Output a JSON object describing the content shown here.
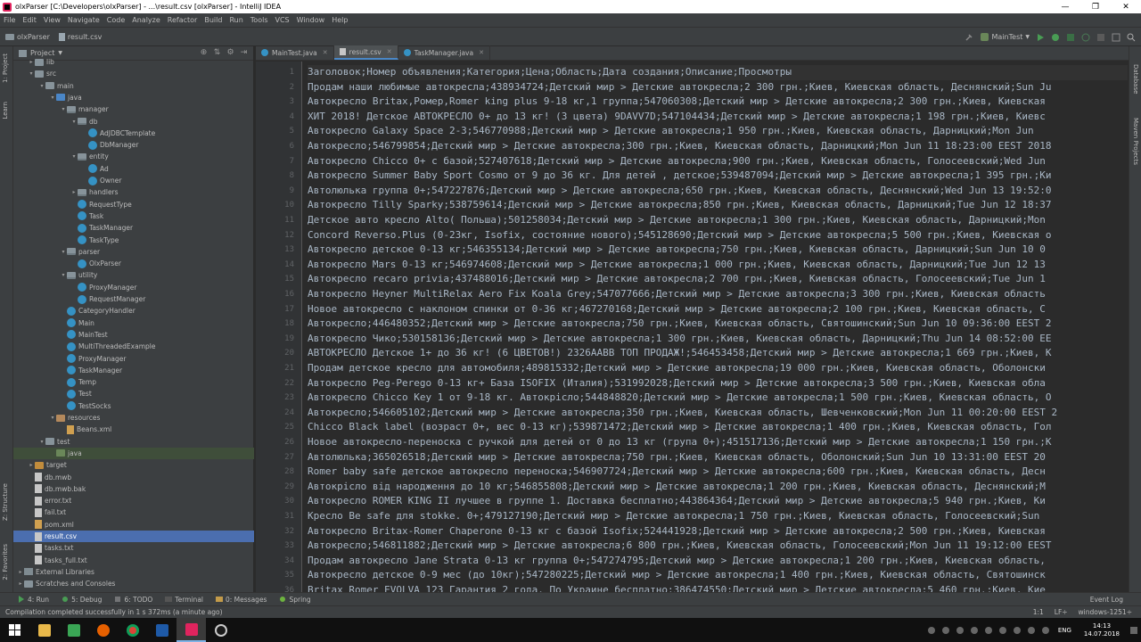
{
  "window": {
    "title": "olxParser [C:\\Developers\\olxParser] - ...\\result.csv [olxParser] - IntelliJ IDEA",
    "minimize": "—",
    "maximize": "❐",
    "close": "✕"
  },
  "menu": [
    "File",
    "Edit",
    "View",
    "Navigate",
    "Code",
    "Analyze",
    "Refactor",
    "Build",
    "Run",
    "Tools",
    "VCS",
    "Window",
    "Help"
  ],
  "breadcrumb": {
    "project": "olxParser",
    "file": "result.csv"
  },
  "run_config": "MainTest",
  "project_panel": {
    "title": "Project"
  },
  "left_tabs": {
    "project": "1: Project",
    "learn": "Learn",
    "structure": "Z: Structure",
    "favorites": "2: Favorites"
  },
  "right_tabs": {
    "database": "Database",
    "maven": "Maven Projects"
  },
  "tree": [
    {
      "label": "lib",
      "depth": 1,
      "icon": "folder",
      "arrow": "▸"
    },
    {
      "label": "src",
      "depth": 1,
      "icon": "folder",
      "arrow": "▾"
    },
    {
      "label": "main",
      "depth": 2,
      "icon": "folder",
      "arrow": "▾"
    },
    {
      "label": "java",
      "depth": 3,
      "icon": "src",
      "arrow": "▾"
    },
    {
      "label": "manager",
      "depth": 4,
      "icon": "pkg",
      "arrow": "▾"
    },
    {
      "label": "db",
      "depth": 5,
      "icon": "pkg",
      "arrow": "▾"
    },
    {
      "label": "AdJDBCTemplate",
      "depth": 6,
      "icon": "cls",
      "arrow": ""
    },
    {
      "label": "DbManager",
      "depth": 6,
      "icon": "cls",
      "arrow": ""
    },
    {
      "label": "entity",
      "depth": 5,
      "icon": "pkg",
      "arrow": "▾"
    },
    {
      "label": "Ad",
      "depth": 6,
      "icon": "cls",
      "arrow": ""
    },
    {
      "label": "Owner",
      "depth": 6,
      "icon": "cls",
      "arrow": ""
    },
    {
      "label": "handlers",
      "depth": 5,
      "icon": "pkg",
      "arrow": "▸"
    },
    {
      "label": "RequestType",
      "depth": 5,
      "icon": "enm",
      "arrow": ""
    },
    {
      "label": "Task",
      "depth": 5,
      "icon": "cls",
      "arrow": ""
    },
    {
      "label": "TaskManager",
      "depth": 5,
      "icon": "cls",
      "arrow": ""
    },
    {
      "label": "TaskType",
      "depth": 5,
      "icon": "enm",
      "arrow": ""
    },
    {
      "label": "parser",
      "depth": 4,
      "icon": "pkg",
      "arrow": "▾"
    },
    {
      "label": "OlxParser",
      "depth": 5,
      "icon": "cls",
      "arrow": ""
    },
    {
      "label": "utility",
      "depth": 4,
      "icon": "pkg",
      "arrow": "▾"
    },
    {
      "label": "ProxyManager",
      "depth": 5,
      "icon": "cls",
      "arrow": ""
    },
    {
      "label": "RequestManager",
      "depth": 5,
      "icon": "cls",
      "arrow": ""
    },
    {
      "label": "CategoryHandler",
      "depth": 4,
      "icon": "cls",
      "arrow": ""
    },
    {
      "label": "Main",
      "depth": 4,
      "icon": "cls",
      "arrow": ""
    },
    {
      "label": "MainTest",
      "depth": 4,
      "icon": "cls",
      "arrow": ""
    },
    {
      "label": "MultiThreadedExample",
      "depth": 4,
      "icon": "cls",
      "arrow": ""
    },
    {
      "label": "ProxyManager",
      "depth": 4,
      "icon": "cls",
      "arrow": ""
    },
    {
      "label": "TaskManager",
      "depth": 4,
      "icon": "cls",
      "arrow": ""
    },
    {
      "label": "Temp",
      "depth": 4,
      "icon": "cls",
      "arrow": ""
    },
    {
      "label": "Test",
      "depth": 4,
      "icon": "cls",
      "arrow": ""
    },
    {
      "label": "TestSocks",
      "depth": 4,
      "icon": "cls",
      "arrow": ""
    },
    {
      "label": "resources",
      "depth": 3,
      "icon": "res",
      "arrow": "▾"
    },
    {
      "label": "Beans.xml",
      "depth": 4,
      "icon": "xml",
      "arrow": ""
    },
    {
      "label": "test",
      "depth": 2,
      "icon": "folder",
      "arrow": "▾"
    },
    {
      "label": "java",
      "depth": 3,
      "icon": "tst",
      "arrow": "",
      "hl": true
    },
    {
      "label": "target",
      "depth": 1,
      "icon": "target",
      "arrow": "▸"
    },
    {
      "label": "db.mwb",
      "depth": 1,
      "icon": "txt",
      "arrow": ""
    },
    {
      "label": "db.mwb.bak",
      "depth": 1,
      "icon": "txt",
      "arrow": ""
    },
    {
      "label": "error.txt",
      "depth": 1,
      "icon": "txt",
      "arrow": ""
    },
    {
      "label": "fail.txt",
      "depth": 1,
      "icon": "txt",
      "arrow": ""
    },
    {
      "label": "pom.xml",
      "depth": 1,
      "icon": "xml",
      "arrow": ""
    },
    {
      "label": "result.csv",
      "depth": 1,
      "icon": "txt",
      "arrow": "",
      "sel": true
    },
    {
      "label": "tasks.txt",
      "depth": 1,
      "icon": "txt",
      "arrow": ""
    },
    {
      "label": "tasks_full.txt",
      "depth": 1,
      "icon": "txt",
      "arrow": ""
    },
    {
      "label": "External Libraries",
      "depth": 0,
      "icon": "lib",
      "arrow": "▸"
    },
    {
      "label": "Scratches and Consoles",
      "depth": 0,
      "icon": "folder",
      "arrow": "▸"
    }
  ],
  "tabs": [
    {
      "label": "MainTest.java",
      "type": "java",
      "active": false
    },
    {
      "label": "result.csv",
      "type": "csv",
      "active": true
    },
    {
      "label": "TaskManager.java",
      "type": "java",
      "active": false
    }
  ],
  "lines": [
    "Заголовок;Номер объявления;Категория;Цена;Область;Дата создания;Описание;Просмотры",
    "Продам наши любимые автокресла;438934724;Детский мир > Детские автокресла;2 300 грн.;Киев, Киевская область, Деснянский;Sun Ju",
    "Автокресло Britax,Ромер,Romer king plus 9-18 кг,1 группа;547060308;Детский мир > Детские автокресла;2 300 грн.;Киев, Киевская",
    "ХИТ 2018! Детское АВТОКРЕСЛО 0+ до 13 кг! (3 цвета) 9DAVV7D;547104434;Детский мир > Детские автокресла;1 198 грн.;Киев, Киевс",
    "Автокресло Galaxy Space 2-3;546770988;Детский мир > Детские автокресла;1 950 грн.;Киев, Киевская область, Дарницкий;Mon Jun",
    "Автокресло;546799854;Детский мир > Детские автокресла;300 грн.;Киев, Киевская область, Дарницкий;Mon Jun 11 18:23:00 EEST 2018",
    "Автокресло Chicco 0+ с базой;527407618;Детский мир > Детские автокресла;900 грн.;Киев, Киевская область, Голосеевский;Wed Jun",
    "Автокресло Summer Baby Sport Cosmo от 9 до 36 кг. Для детей , детское;539487094;Детский мир > Детские автокресла;1 395 грн.;Ки",
    "Автолюлька группа 0+;547227876;Детский мир > Детские автокресла;650 грн.;Киев, Киевская область, Деснянский;Wed Jun 13 19:52:0",
    "Автокресло Tilly Sparky;538759614;Детский мир > Детские автокресла;850 грн.;Киев, Киевская область, Дарницкий;Tue Jun 12 18:37",
    "Детское авто кресло Alto( Польша);501258034;Детский мир > Детские автокресла;1 300 грн.;Киев, Киевская область, Дарницкий;Mon",
    "Concord Reverso.Plus (0-23кг, Isofix, состояние нового);545128690;Детский мир > Детские автокресла;5 500 грн.;Киев, Киевская о",
    "Автокресло детское 0-13 кг;546355134;Детский мир > Детские автокресла;750 грн.;Киев, Киевская область, Дарницкий;Sun Jun 10 0",
    "Автокресло Mars 0-13 кг;546974608;Детский мир > Детские автокресла;1 000 грн.;Киев, Киевская область, Дарницкий;Tue Jun 12 13",
    "Автокресло recaro privia;437488016;Детский мир > Детские автокресла;2 700 грн.;Киев, Киевская область, Голосеевский;Tue Jun 1",
    "Автокресло Heyner MultiRelax Aero Fix Koala Grey;547077666;Детский мир > Детские автокресла;3 300 грн.;Киев, Киевская область",
    "Новое автокресло с наклоном спинки от 0-36 кг;467270168;Детский мир > Детские автокресла;2 100 грн.;Киев, Киевская область, С",
    "Автокресло;446480352;Детский мир > Детские автокресла;750 грн.;Киев, Киевская область, Святошинский;Sun Jun 10 09:36:00 EEST 2",
    "Автокресло Чико;530158136;Детский мир > Детские автокресла;1 300 грн.;Киев, Киевская область, Дарницкий;Thu Jun 14 08:52:00 EE",
    "АВТОКРЕСЛО Детское 1+ до 36 кг! (6 ЦВЕТОВ!) 2326AABB ТОП ПРОДАЖ!;546453458;Детский мир > Детские автокресла;1 669 грн.;Киев, К",
    "Продам детское кресло для автомобиля;489815332;Детский мир > Детские автокресла;19 000 грн.;Киев, Киевская область, Оболонски",
    "Автокресло Peg-Perego 0-13 кг+ База ISOFIX (Италия);531992028;Детский мир > Детские автокресла;3 500 грн.;Киев, Киевская обла",
    "Автокресло Chicco Key 1 от 9-18 кг. Автокрісло;544848820;Детский мир > Детские автокресла;1 500 грн.;Киев, Киевская область, О",
    "Автокресло;546605102;Детский мир > Детские автокресла;350 грн.;Киев, Киевская область, Шевченковский;Mon Jun 11 00:20:00 EEST 2",
    "Chicco Black label (возраст 0+, вес 0-13 кг);539871472;Детский мир > Детские автокресла;1 400 грн.;Киев, Киевская область, Гол",
    "Новое автокресло-переноска с ручкой для детей от 0 до 13 кг (група 0+);451517136;Детский мир > Детские автокресла;1 150 грн.;К",
    "Автолюлька;365026518;Детский мир > Детские автокресла;750 грн.;Киев, Киевская область, Оболонский;Sun Jun 10 13:31:00 EEST 20",
    "Romer baby safe детское автокресло переноска;546907724;Детский мир > Детские автокресла;600 грн.;Киев, Киевская область, Десн",
    "Автокрісло від народження до 10 кг;546855808;Детский мир > Детские автокресла;1 200 грн.;Киев, Киевская область, Деснянский;M",
    "Автокресло ROMER KING II лучшее в группе 1. Доставка бесплатно;443864364;Детский мир > Детские автокресла;5 940 грн.;Киев, Ки",
    "Кресло Be safe для stokke. 0+;479127190;Детский мир > Детские автокресла;1 750 грн.;Киев, Киевская область, Голосеевский;Sun ",
    "Автокресло Britax-Romer Chaperone 0-13 кг с базой Isofix;524441928;Детский мир > Детские автокресла;2 500 грн.;Киев, Киевская",
    "Автокресло;546811882;Детский мир > Детские автокресла;6 800 грн.;Киев, Киевская область, Голосеевский;Mon Jun 11 19:12:00 EEST",
    "Продам автокресло Jane Strata 0-13 кг группа 0+;547274795;Детский мир > Детские автокресла;1 200 грн.;Киев, Киевская область,",
    "Автокресло детское 0-9 мес (до 10кг);547280225;Детский мир > Детские автокресла;1 400 грн.;Киев, Киевская область, Святошинск",
    "Britax Romer EVOLVA 123 Гарантия 2 года. По Украине бесплатно;386474550;Детский мир > Детские автокресла;5 460 грн.;Киев, Кие"
  ],
  "bottom_tools": {
    "run": "4: Run",
    "debug": "5: Debug",
    "todo": "6: TODO",
    "terminal": "Terminal",
    "messages": "0: Messages",
    "spring": "Spring",
    "event_log": "Event Log"
  },
  "status": {
    "message": "Compilation completed successfully in 1 s 372ms (a minute ago)",
    "position": "1:1",
    "line_sep": "LF÷",
    "encoding": "windows-1251÷"
  },
  "taskbar": {
    "lang": "ENG",
    "time": "14:13",
    "date": "14.07.2018"
  },
  "colors": {
    "accent": "#4a88c7",
    "editor_bg": "#2b2b2b",
    "panel_bg": "#3c3f41"
  }
}
